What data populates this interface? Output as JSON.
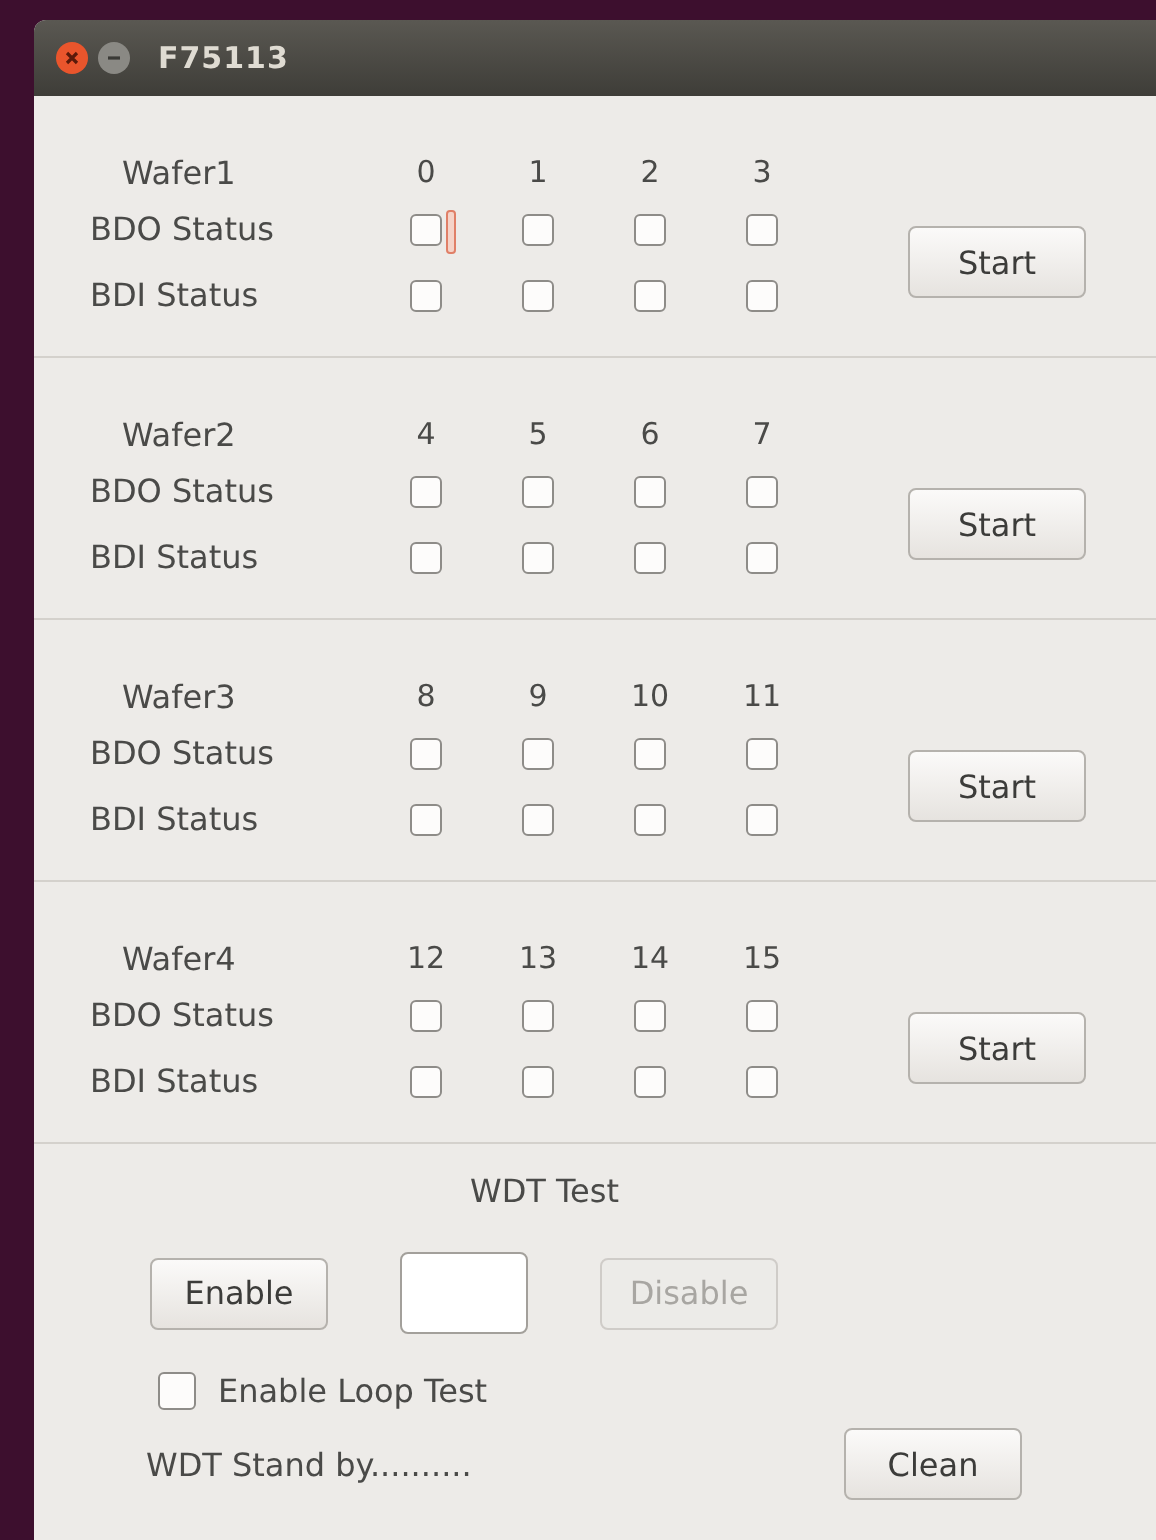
{
  "window": {
    "title": "F75113"
  },
  "wafers": [
    {
      "label": "Wafer1",
      "bits": [
        "0",
        "1",
        "2",
        "3"
      ],
      "rows": [
        {
          "label": "BDO Status",
          "boxes": [
            {
              "checked": false,
              "focused": true
            },
            {
              "checked": false,
              "focused": false
            },
            {
              "checked": false,
              "focused": false
            },
            {
              "checked": false,
              "focused": false
            }
          ]
        },
        {
          "label": "BDI Status",
          "boxes": [
            {
              "checked": false,
              "focused": false
            },
            {
              "checked": false,
              "focused": false
            },
            {
              "checked": false,
              "focused": false
            },
            {
              "checked": false,
              "focused": false
            }
          ]
        }
      ],
      "button": "Start"
    },
    {
      "label": "Wafer2",
      "bits": [
        "4",
        "5",
        "6",
        "7"
      ],
      "rows": [
        {
          "label": "BDO Status",
          "boxes": [
            {
              "checked": false,
              "focused": false
            },
            {
              "checked": false,
              "focused": false
            },
            {
              "checked": false,
              "focused": false
            },
            {
              "checked": false,
              "focused": false
            }
          ]
        },
        {
          "label": "BDI Status",
          "boxes": [
            {
              "checked": false,
              "focused": false
            },
            {
              "checked": false,
              "focused": false
            },
            {
              "checked": false,
              "focused": false
            },
            {
              "checked": false,
              "focused": false
            }
          ]
        }
      ],
      "button": "Start"
    },
    {
      "label": "Wafer3",
      "bits": [
        "8",
        "9",
        "10",
        "11"
      ],
      "rows": [
        {
          "label": "BDO Status",
          "boxes": [
            {
              "checked": false,
              "focused": false
            },
            {
              "checked": false,
              "focused": false
            },
            {
              "checked": false,
              "focused": false
            },
            {
              "checked": false,
              "focused": false
            }
          ]
        },
        {
          "label": "BDI Status",
          "boxes": [
            {
              "checked": false,
              "focused": false
            },
            {
              "checked": false,
              "focused": false
            },
            {
              "checked": false,
              "focused": false
            },
            {
              "checked": false,
              "focused": false
            }
          ]
        }
      ],
      "button": "Start"
    },
    {
      "label": "Wafer4",
      "bits": [
        "12",
        "13",
        "14",
        "15"
      ],
      "rows": [
        {
          "label": "BDO Status",
          "boxes": [
            {
              "checked": false,
              "focused": false
            },
            {
              "checked": false,
              "focused": false
            },
            {
              "checked": false,
              "focused": false
            },
            {
              "checked": false,
              "focused": false
            }
          ]
        },
        {
          "label": "BDI Status",
          "boxes": [
            {
              "checked": false,
              "focused": false
            },
            {
              "checked": false,
              "focused": false
            },
            {
              "checked": false,
              "focused": false
            },
            {
              "checked": false,
              "focused": false
            }
          ]
        }
      ],
      "button": "Start"
    }
  ],
  "wdt": {
    "title": "WDT Test",
    "buttons": [
      {
        "label": "Enable",
        "disabled": false
      },
      {
        "label": "Disable",
        "disabled": true
      }
    ],
    "loop": {
      "label": "Enable Loop Test",
      "checked": false
    },
    "status": "WDT Stand by..........",
    "clean": "Clean"
  }
}
